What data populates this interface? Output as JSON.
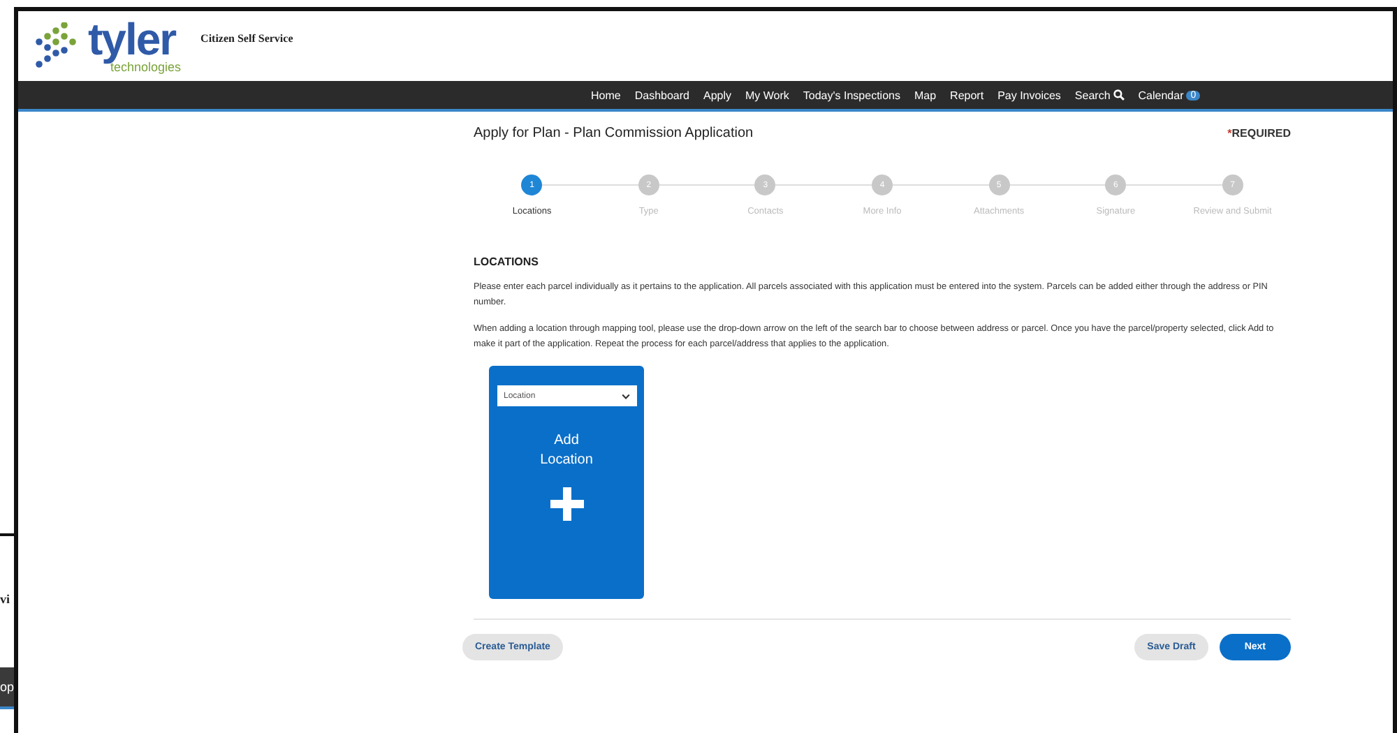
{
  "background_window": {
    "fragment_text": "vi",
    "bar_text": "op"
  },
  "header": {
    "logo_word": "tyler",
    "logo_subword": "technologies",
    "site_title": "Citizen Self Service"
  },
  "nav": {
    "items": [
      {
        "label": "Home",
        "kind": "link"
      },
      {
        "label": "Dashboard",
        "kind": "link"
      },
      {
        "label": "Apply",
        "kind": "link"
      },
      {
        "label": "My Work",
        "kind": "link"
      },
      {
        "label": "Today's Inspections",
        "kind": "link"
      },
      {
        "label": "Map",
        "kind": "link"
      },
      {
        "label": "Report",
        "kind": "link"
      },
      {
        "label": "Pay Invoices",
        "kind": "link"
      },
      {
        "label": "Search",
        "kind": "search"
      },
      {
        "label": "Calendar",
        "kind": "badge",
        "badge": "0"
      }
    ]
  },
  "page": {
    "title": "Apply for Plan - Plan Commission Application",
    "required_mark": "*",
    "required_label": "REQUIRED"
  },
  "steps": [
    {
      "number": "1",
      "label": "Locations",
      "selected": true
    },
    {
      "number": "2",
      "label": "Type",
      "selected": false
    },
    {
      "number": "3",
      "label": "Contacts",
      "selected": false
    },
    {
      "number": "4",
      "label": "More Info",
      "selected": false
    },
    {
      "number": "5",
      "label": "Attachments",
      "selected": false
    },
    {
      "number": "6",
      "label": "Signature",
      "selected": false
    },
    {
      "number": "7",
      "label": "Review and Submit",
      "selected": false
    }
  ],
  "section": {
    "heading": "LOCATIONS",
    "paragraphs": [
      "Please enter each parcel individually as it pertains to the application. All parcels associated with this application must be entered into the system. Parcels can be added either through the address or PIN number.",
      "When adding a location through mapping tool, please use the drop-down arrow on the left of the search bar to choose between address or parcel. Once you have the parcel/property selected, click Add to make it part of the application. Repeat the process for each parcel/address that applies to the application."
    ]
  },
  "add_card": {
    "select_value": "Location",
    "title_line_1": "Add",
    "title_line_2": "Location"
  },
  "footer": {
    "buttons": [
      {
        "label": "Create Template",
        "kind": "secondary"
      },
      {
        "label": "Save Draft",
        "kind": "secondary"
      },
      {
        "label": "Next",
        "kind": "primary"
      }
    ]
  }
}
